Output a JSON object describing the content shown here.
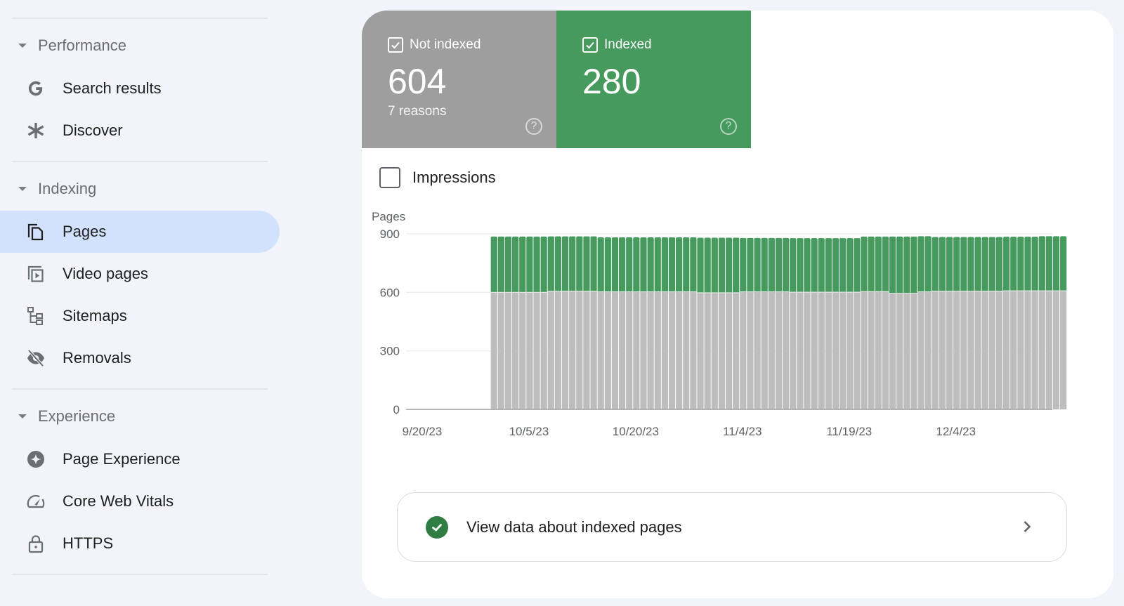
{
  "sidebar": {
    "sections": [
      {
        "title": "Performance",
        "items": [
          {
            "label": "Search results",
            "icon": "google-g-icon"
          },
          {
            "label": "Discover",
            "icon": "asterisk-icon"
          }
        ]
      },
      {
        "title": "Indexing",
        "items": [
          {
            "label": "Pages",
            "icon": "pages-icon",
            "active": true
          },
          {
            "label": "Video pages",
            "icon": "video-pages-icon"
          },
          {
            "label": "Sitemaps",
            "icon": "sitemap-icon"
          },
          {
            "label": "Removals",
            "icon": "eye-off-icon"
          }
        ]
      },
      {
        "title": "Experience",
        "items": [
          {
            "label": "Page Experience",
            "icon": "sparkle-icon"
          },
          {
            "label": "Core Web Vitals",
            "icon": "speedometer-icon"
          },
          {
            "label": "HTTPS",
            "icon": "lock-icon"
          }
        ]
      }
    ]
  },
  "summary": {
    "not_indexed": {
      "label": "Not indexed",
      "value": "604",
      "sub": "7 reasons",
      "checked": true,
      "color": "#9e9e9e"
    },
    "indexed": {
      "label": "Indexed",
      "value": "280",
      "checked": true,
      "color": "#479a5e"
    }
  },
  "impressions_toggle": {
    "label": "Impressions",
    "checked": false
  },
  "chart_data": {
    "type": "bar",
    "stacked": true,
    "title": "",
    "ylabel": "Pages",
    "xlabel": "",
    "ylim": [
      0,
      900
    ],
    "yticks": [
      0,
      300,
      600,
      900
    ],
    "xtick_labels": [
      "9/20/23",
      "10/5/23",
      "10/20/23",
      "11/4/23",
      "11/19/23",
      "12/4/23"
    ],
    "x_start": "9/20/23",
    "first_bar_day_offset": 5,
    "grid": true,
    "legend": "none",
    "series": [
      {
        "name": "Not indexed",
        "color": "#bdbdbd",
        "runs": [
          [
            8,
            600
          ],
          [
            7,
            606
          ],
          [
            14,
            603
          ],
          [
            6,
            598
          ],
          [
            7,
            603
          ],
          [
            10,
            601
          ],
          [
            4,
            604
          ],
          [
            4,
            595
          ],
          [
            2,
            603
          ],
          [
            10,
            606
          ],
          [
            9,
            608
          ]
        ]
      },
      {
        "name": "Indexed",
        "color": "#479a5e",
        "runs": [
          [
            8,
            286
          ],
          [
            7,
            281
          ],
          [
            14,
            279
          ],
          [
            6,
            282
          ],
          [
            7,
            276
          ],
          [
            10,
            277
          ],
          [
            4,
            282
          ],
          [
            4,
            291
          ],
          [
            2,
            285
          ],
          [
            10,
            278
          ],
          [
            5,
            277
          ],
          [
            4,
            280
          ]
        ]
      }
    ]
  },
  "indexed_link": {
    "label": "View data about indexed pages",
    "icon": "check-circle-icon"
  }
}
